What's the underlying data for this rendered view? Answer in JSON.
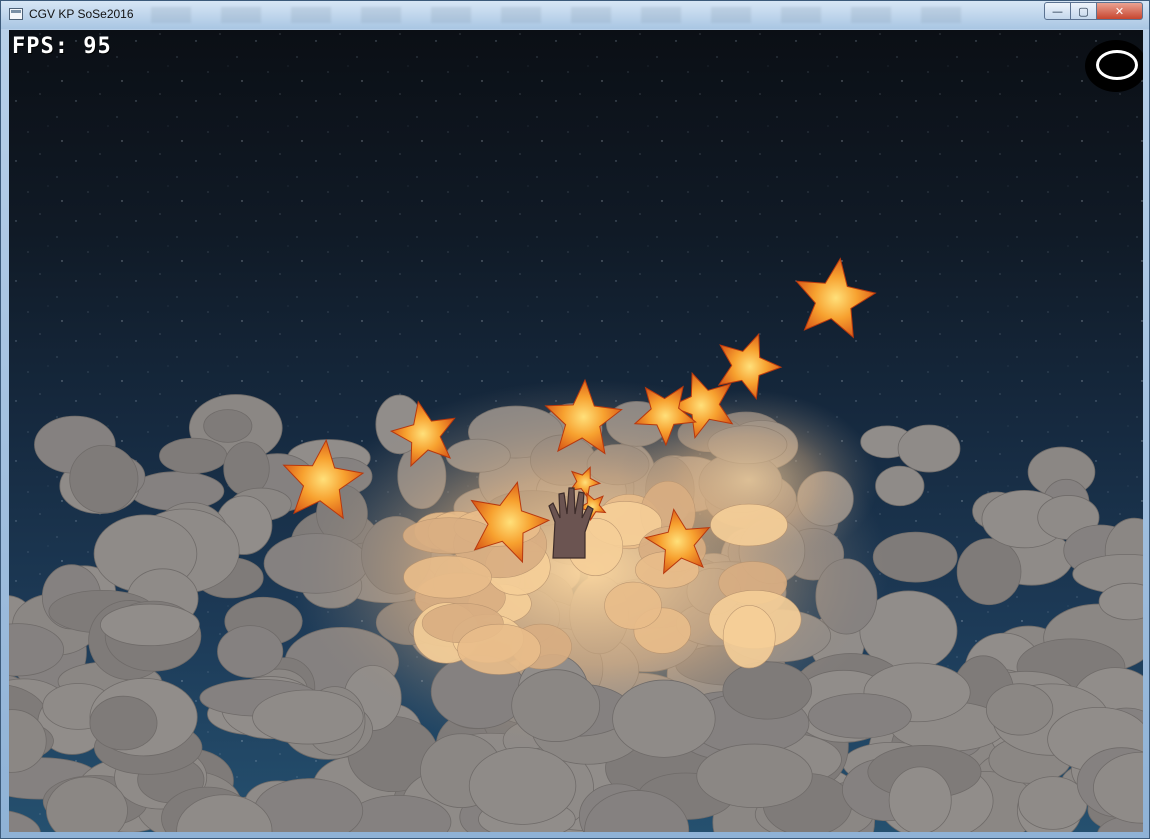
{
  "window": {
    "title": "CGV KP SoSe2016",
    "controls": {
      "minimize": "—",
      "maximize": "▢",
      "close": "✕"
    }
  },
  "hud": {
    "fps_label": "FPS:",
    "fps_value": "95"
  },
  "icons": {
    "app": "window-icon",
    "moon_button": "moon-icon",
    "hand": "hand-icon",
    "star": "star-icon",
    "cloud": "cloud-icon"
  },
  "colors": {
    "sky_top": "#0b0f15",
    "sky_bottom": "#25506f",
    "cloud": "#8b8784",
    "cloud_glow": "#ffd59a",
    "star_fill": "#f07a1e",
    "star_core": "#ffcf5a",
    "hand": "#6a5350"
  },
  "scene": {
    "star_count": 11,
    "hand_visible": true
  }
}
